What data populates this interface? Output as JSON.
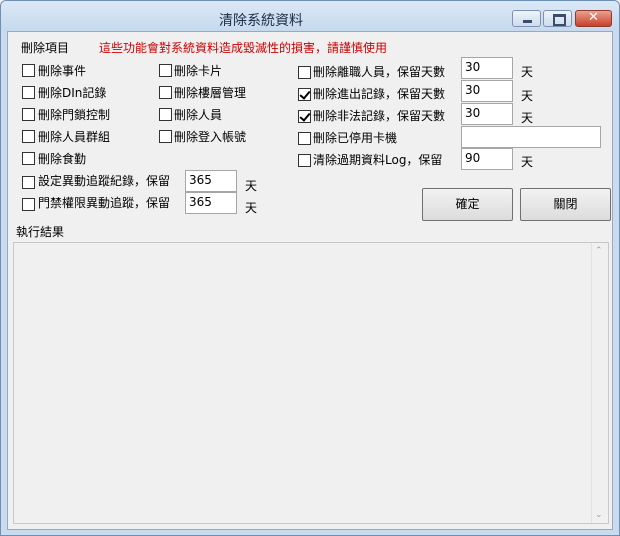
{
  "window": {
    "title": "清除系統資料",
    "controls": {
      "minimize": "minimize-icon",
      "maximize": "maximize-icon",
      "close": "close-icon"
    }
  },
  "section": {
    "label": "刪除項目",
    "warning": "這些功能會對系統資料造成毀滅性的損害，請謹慎使用",
    "warning_color": "#cc0000"
  },
  "col1": [
    {
      "label": "刪除事件",
      "checked": false
    },
    {
      "label": "刪除DIn記錄",
      "checked": false
    },
    {
      "label": "刪除門鎖控制",
      "checked": false
    },
    {
      "label": "刪除人員群組",
      "checked": false
    },
    {
      "label": "刪除食勤",
      "checked": false
    }
  ],
  "col2": [
    {
      "label": "刪除卡片",
      "checked": false
    },
    {
      "label": "刪除樓層管理",
      "checked": false
    },
    {
      "label": "刪除人員",
      "checked": false
    },
    {
      "label": "刪除登入帳號",
      "checked": false
    }
  ],
  "col3": [
    {
      "label": "刪除離職人員，保留天數",
      "checked": false,
      "value": "30",
      "unit": "天"
    },
    {
      "label": "刪除進出記錄，保留天數",
      "checked": true,
      "value": "30",
      "unit": "天"
    },
    {
      "label": "刪除非法記錄，保留天數",
      "checked": true,
      "value": "30",
      "unit": "天"
    },
    {
      "label": "刪除已停用卡機",
      "checked": false,
      "value": "",
      "unit": ""
    },
    {
      "label": "清除過期資料Log，保留",
      "checked": false,
      "value": "90",
      "unit": "天"
    }
  ],
  "retain": [
    {
      "label": "設定異動追蹤紀錄，保留",
      "checked": false,
      "value": "365",
      "unit": "天"
    },
    {
      "label": "門禁權限異動追蹤，保留",
      "checked": false,
      "value": "365",
      "unit": "天"
    }
  ],
  "buttons": {
    "ok": "確定",
    "close": "關閉"
  },
  "results": {
    "label": "執行結果",
    "content": ""
  }
}
